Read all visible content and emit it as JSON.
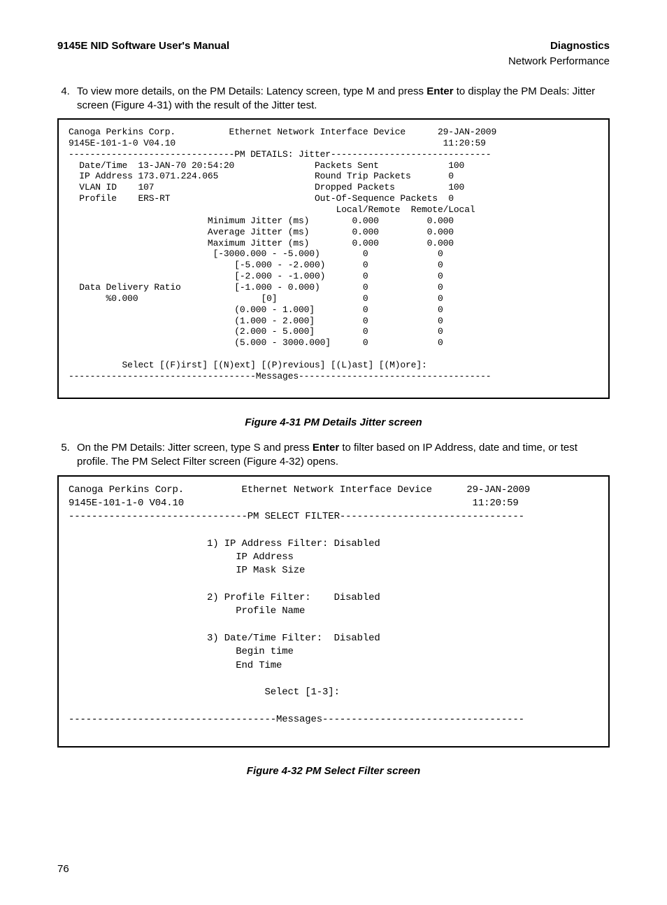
{
  "header": {
    "left": "9145E NID Software User's Manual",
    "right": "Diagnostics",
    "sub": "Network Performance"
  },
  "step4": {
    "num": "4.",
    "text_a": "To view more details, on the PM Details: Latency screen, type M and press ",
    "bold": "Enter",
    "text_b": " to display the PM Deals: Jitter screen (Figure 4-31) with the result of the Jitter test."
  },
  "terminal1": "Canoga Perkins Corp.          Ethernet Network Interface Device      29-JAN-2009\n9145E-101-1-0 V04.10                                                  11:20:59\n-------------------------------PM DETAILS: Jitter------------------------------\n  Date/Time  13-JAN-70 20:54:20               Packets Sent             100\n  IP Address 173.071.224.065                  Round Trip Packets       0\n  VLAN ID    107                              Dropped Packets          100\n  Profile    ERS-RT                           Out-Of-Sequence Packets  0\n                                                  Local/Remote  Remote/Local\n                          Minimum Jitter (ms)        0.000         0.000\n                          Average Jitter (ms)        0.000         0.000\n                          Maximum Jitter (ms)        0.000         0.000\n                           [-3000.000 - -5.000)        0             0\n                               [-5.000 - -2.000)       0             0\n                               [-2.000 - -1.000)       0             0\n  Data Delivery Ratio          [-1.000 - 0.000)        0             0\n       %0.000                       [0]                0             0\n                               (0.000 - 1.000]         0             0\n                               (1.000 - 2.000]         0             0\n                               (2.000 - 5.000]         0             0\n                               (5.000 - 3000.000]      0             0\n\n          Select [(F)irst] [(N)ext] [(P)revious] [(L)ast] [(M)ore]:\n-----------------------------------Messages------------------------------------",
  "caption1": "Figure 4-31  PM Details Jitter screen",
  "step5": {
    "num": "5.",
    "text_a": "On the PM Details: Jitter screen, type S and press ",
    "bold": "Enter",
    "text_b": " to filter based on IP Address, date and time, or test profile. The PM Select Filter screen (Figure 4-32) opens."
  },
  "terminal2": "Canoga Perkins Corp.          Ethernet Network Interface Device      29-JAN-2009\n9145E-101-1-0 V04.10                                                  11:20:59\n-------------------------------PM SELECT FILTER--------------------------------\n\n                        1) IP Address Filter: Disabled\n                             IP Address\n                             IP Mask Size\n\n                        2) Profile Filter:    Disabled\n                             Profile Name\n\n                        3) Date/Time Filter:  Disabled\n                             Begin time\n                             End Time\n\n                                  Select [1-3]:\n\n------------------------------------Messages-----------------------------------",
  "caption2": "Figure 4-32  PM Select Filter screen",
  "pagenum": "76"
}
